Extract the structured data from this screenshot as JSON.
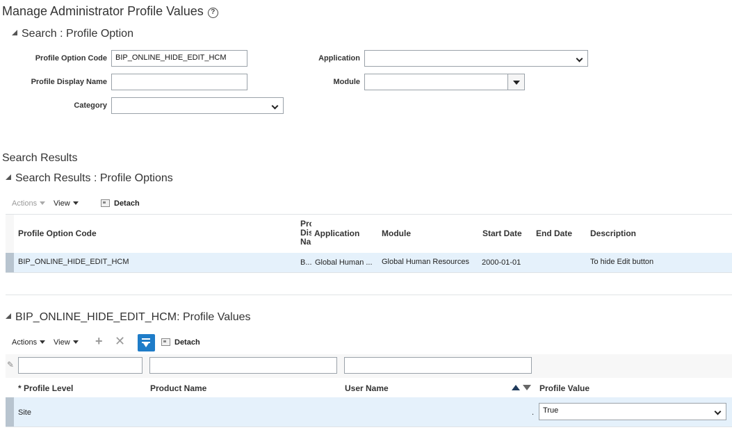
{
  "page": {
    "title": "Manage Administrator Profile Values",
    "help_icon": "help-icon"
  },
  "search": {
    "section_title": "Search : Profile Option",
    "profile_option_code_label": "Profile Option Code",
    "profile_option_code_value": "BIP_ONLINE_HIDE_EDIT_HCM",
    "profile_display_name_label": "Profile Display Name",
    "profile_display_name_value": "",
    "category_label": "Category",
    "category_value": "",
    "application_label": "Application",
    "application_value": "",
    "module_label": "Module",
    "module_value": ""
  },
  "results": {
    "heading": "Search Results",
    "section_title": "Search Results : Profile Options",
    "toolbar": {
      "actions": "Actions",
      "view": "View",
      "detach": "Detach"
    },
    "columns": {
      "code": "Profile Option Code",
      "display_name_truncated": [
        "Pro",
        "Dis",
        "Na"
      ],
      "application": "Application",
      "module": "Module",
      "start_date": "Start Date",
      "end_date": "End Date",
      "description": "Description"
    },
    "rows": [
      {
        "code": "BIP_ONLINE_HIDE_EDIT_HCM",
        "display_name": "B...",
        "application": "Global Human ...",
        "module": "Global Human Resources",
        "start_date": "2000-01-01",
        "end_date": "",
        "description": "To hide Edit button"
      }
    ]
  },
  "values": {
    "section_title": "BIP_ONLINE_HIDE_EDIT_HCM: Profile Values",
    "toolbar": {
      "actions": "Actions",
      "view": "View",
      "detach": "Detach"
    },
    "filters": [
      "",
      "",
      ""
    ],
    "columns": {
      "required_marker": "*",
      "profile_level": "Profile Level",
      "product_name": "Product Name",
      "user_name": "User Name",
      "profile_value": "Profile Value"
    },
    "rows": [
      {
        "profile_level": "Site",
        "product_name": "",
        "user_name": ".",
        "profile_value": "True"
      }
    ]
  }
}
